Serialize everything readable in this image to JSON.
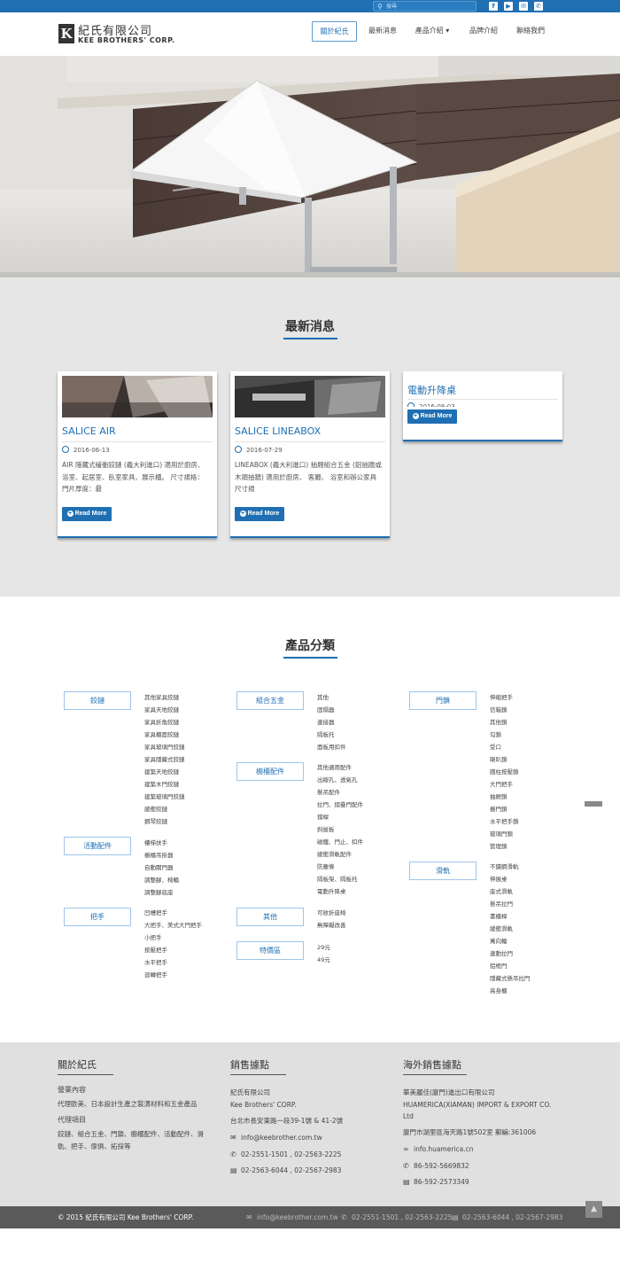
{
  "topbar": {
    "search_placeholder": "搜尋",
    "social": [
      {
        "icon": "facebook-icon",
        "glyph": "f"
      },
      {
        "icon": "youtube-icon",
        "glyph": "▶"
      },
      {
        "icon": "mail-icon",
        "glyph": "✉"
      },
      {
        "icon": "phone-icon",
        "glyph": "✆"
      }
    ]
  },
  "header": {
    "logo_mark": "K",
    "logo_zh": "紀氏有限公司",
    "logo_en": "KEE BROTHERS' CORP.",
    "nav": [
      {
        "label": "關於紀氏",
        "active": true
      },
      {
        "label": "最新消息",
        "active": false
      },
      {
        "label": "產品介紹 ▾",
        "active": false
      },
      {
        "label": "品牌介紹",
        "active": false
      },
      {
        "label": "聯絡我們",
        "active": false
      }
    ]
  },
  "news": {
    "title": "最新消息",
    "read_more": "Read More",
    "cards": [
      {
        "title": "SALICE AIR",
        "date": "2016-06-13",
        "desc": "AIR 隱藏式緩衝鉸鏈 (義大利進口) 適用於廚房、浴室、起居室、臥室家具、展示櫃。 尺寸規格： 門片厚度：最"
      },
      {
        "title": "SALICE LINEABOX",
        "date": "2016-07-29",
        "desc": "LINEABOX (義大利進口) 抽屜組合五金 (鋁抽牆或木頭抽牆) 適用於廚房、 客廳、 浴室和辦公家具 尺寸規"
      },
      {
        "title": "電動升降桌",
        "date": "2016-08-03",
        "desc": ""
      }
    ]
  },
  "categories": {
    "title": "產品分類",
    "columns": [
      [
        {
          "label": "鉸鏈",
          "items": [
            "其他家具鉸鏈",
            "家具天地鉸鏈",
            "家具折角鉸鏈",
            "家具櫃面鉸鏈",
            "家具玻璃門鉸鏈",
            "家具隱藏式鉸鏈",
            "建築天地鉸鏈",
            "建築木門鉸鏈",
            "建築玻璃門鉸鏈",
            "緩衝鉸鏈",
            "鋼琴鉸鏈"
          ]
        },
        {
          "label": "活動配件",
          "items": [
            "樓梯扶手",
            "櫥櫃吊掛器",
            "自動關門器",
            "調整腳、椅輪",
            "調整腳底座"
          ]
        },
        {
          "label": "把手",
          "items": [
            "凹槽把手",
            "大把手、美式大門把手",
            "小把手",
            "按壓把手",
            "水平把手",
            "迴轉把手"
          ]
        }
      ],
      [
        {
          "label": "組合五金",
          "items": [
            "其他",
            "固隔器",
            "連接器",
            "隔板托",
            "面板用扣件"
          ]
        },
        {
          "label": "櫥櫃配件",
          "items": [
            "其他適用配件",
            "出線孔、透氣孔",
            "懸吊配件",
            "拉門、摺疊門配件",
            "撐桿",
            "斜拔板",
            "磁鐵、門止、扣件",
            "緩衝滑軌配件",
            "防塵條",
            "隔板架、隔板托",
            "電動升降桌"
          ]
        },
        {
          "label": "其他",
          "items": [
            "可收折座椅",
            "無障礙改善"
          ]
        },
        {
          "label": "特價區",
          "items": [
            "29元",
            "49元"
          ]
        }
      ],
      [
        {
          "label": "門鎖",
          "items": [
            "伸縮把手",
            "信箱鎖",
            "其他鎖",
            "勾鎖",
            "受口",
            "喇叭鎖",
            "圓柱按壓鎖",
            "大門把手",
            "抽屜鎖",
            "櫥門鎖",
            "水平把手鎖",
            "玻璃門鎖",
            "管理鎖"
          ]
        },
        {
          "label": "滑軌",
          "items": [
            "不鏽鋼滑軌",
            "伸展桌",
            "座式滑軌",
            "懸吊拉門",
            "書櫃桿",
            "緩衝滑軌",
            "萬向輪",
            "連動拉門",
            "鋁框門",
            "隱藏式懸吊拉門",
            "高身櫃"
          ]
        }
      ]
    ]
  },
  "footer": {
    "about": {
      "title": "關於紀氏",
      "business_label": "營業內容",
      "business_text": "代理歐美、日本設計生產之裝潢材料和五金產品",
      "agency_label": "代理項目",
      "agency_text_1": "鉸鏈、組合五金、門鎖、櫥櫃配件、活動配件、滑",
      "agency_text_2": "軌、把手、傢俱、拓採等"
    },
    "sales": {
      "title": "銷售據點",
      "company_zh": "紀氏有限公司",
      "company_en": "Kee Brothers' CORP.",
      "address": "台北市長安東路一段39-1號 & 41-2號",
      "email": "info@keebrother.com.tw",
      "phone": "02-2551-1501 , 02-2563-2225",
      "fax": "02-2563-6044 , 02-2567-2983"
    },
    "overseas": {
      "title": "海外銷售據點",
      "company_zh": "華美麗佳(廈門)進出口有限公司",
      "company_en_1": "HUAMERICA(XIAMAN) IMPORT & EXPORT CO.",
      "company_en_2": "Ltd",
      "address": "廈門市湖里區海天路1號502室 郵編:361006",
      "web": "info.huamerica.cn",
      "phone": "86-592-5669832",
      "fax": "86-592-2573349"
    }
  },
  "copyright": {
    "text": "© 2015 紀氏有限公司 Kee Brothers' CORP.",
    "email": "info@keebrother.com.tw",
    "phone": "02-2551-1501 , 02-2563-2225",
    "fax": "02-2563-6044 , 02-2567-2983"
  },
  "colors": {
    "accent": "#1f6fb2",
    "footer_bg": "#e0e0e0",
    "news_bg": "#e6e6e6",
    "copyright_bg": "#5a5a5a"
  }
}
